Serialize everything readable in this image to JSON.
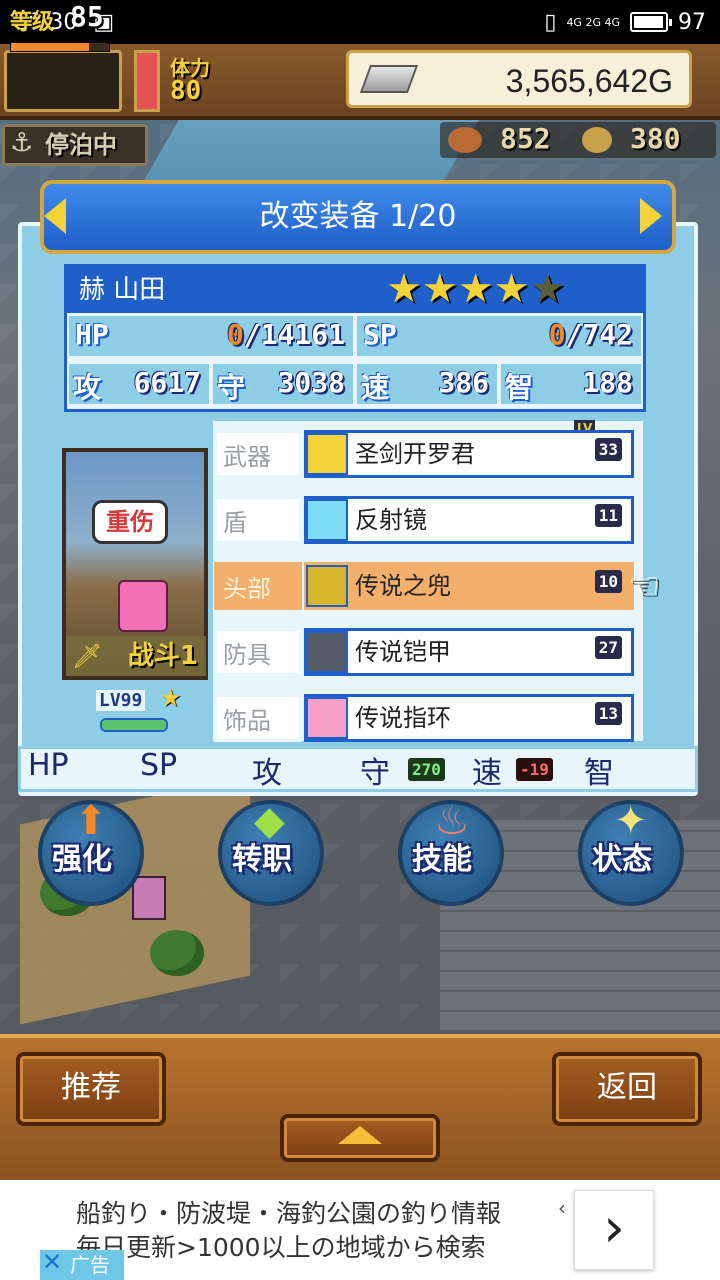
{
  "status_bar": {
    "time": "10:30",
    "network": "4G 2G 4G",
    "battery": "97",
    "battery_fraction": 0.97
  },
  "hud": {
    "level_label": "等级",
    "level_value": "85",
    "level_progress": 0.8,
    "stamina_label": "体力",
    "stamina_value": "80",
    "stamina_fill": 1.0,
    "gold": "3,565,642G",
    "moored_status": "停泊中",
    "resource1": "852",
    "resource2": "380"
  },
  "panel": {
    "title": "改变装备 1/20",
    "character_name": "赫 山田",
    "stars_filled": 4,
    "stars_total": 5,
    "stats": {
      "hp_label": "HP",
      "hp_current": "0",
      "hp_max": "/14161",
      "sp_label": "SP",
      "sp_current": "0",
      "sp_max": "/742",
      "atk_label": "攻",
      "atk_value": "6617",
      "def_label": "守",
      "def_value": "3038",
      "spd_label": "速",
      "spd_value": "386",
      "int_label": "智",
      "int_value": "188"
    },
    "portrait": {
      "status_bubble": "重伤",
      "battle_label": "战斗",
      "battle_count": "1",
      "level": "LV99",
      "hp_fill": 1.0
    },
    "lv_caption": "LV",
    "slots": [
      {
        "category": "武器",
        "item": "圣剑开罗君",
        "level": "33",
        "icon": "sword-icon",
        "icon_color": "#f3d23a",
        "selected": false
      },
      {
        "category": "盾",
        "item": "反射镜",
        "level": "11",
        "icon": "crystal-icon",
        "icon_color": "#7fdcf7",
        "selected": false
      },
      {
        "category": "头部",
        "item": "传说之兜",
        "level": "10",
        "icon": "helmet-icon",
        "icon_color": "#d6b52a",
        "selected": true
      },
      {
        "category": "防具",
        "item": "传说铠甲",
        "level": "27",
        "icon": "armor-icon",
        "icon_color": "#555b66",
        "selected": false
      },
      {
        "category": "饰品",
        "item": "传说指环",
        "level": "13",
        "icon": "ring-icon",
        "icon_color": "#f5a0c8",
        "selected": false
      }
    ],
    "bonus": {
      "hp_label": "HP",
      "sp_label": "SP",
      "atk_label": "攻",
      "def_label": "守",
      "def_bonus": "270",
      "spd_label": "速",
      "spd_bonus": "-19",
      "int_label": "智"
    }
  },
  "actions": [
    {
      "label": "强化",
      "icon": "upgrade-arrow-icon",
      "icon_color": "#f08a2a"
    },
    {
      "label": "转职",
      "icon": "job-change-icon",
      "icon_color": "#9ee04a"
    },
    {
      "label": "技能",
      "icon": "flame-skill-icon",
      "icon_color": "#f07a6a"
    },
    {
      "label": "状态",
      "icon": "sparkle-status-icon",
      "icon_color": "#f3e27a"
    }
  ],
  "bottom": {
    "recommend_label": "推荐",
    "back_label": "返回"
  },
  "ad": {
    "line1": "船釣り・防波堤・海釣公園の釣り情報",
    "line2": "毎日更新>1000以上の地域から検索",
    "tag": "广告"
  }
}
